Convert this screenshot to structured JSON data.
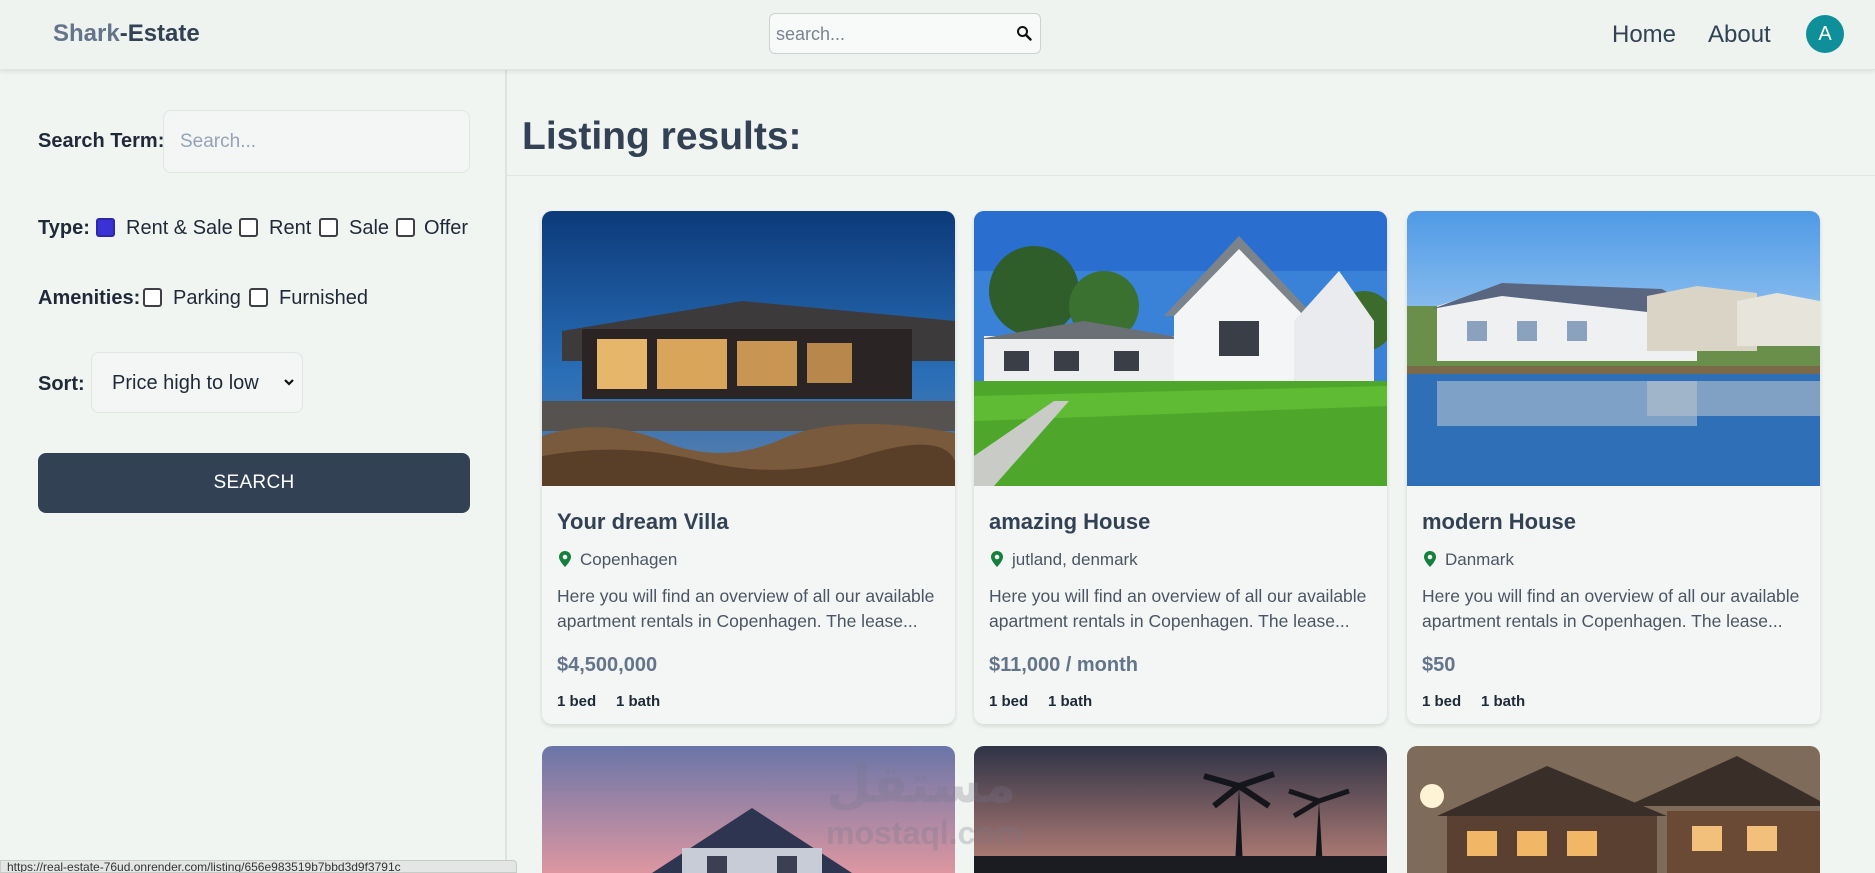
{
  "header": {
    "logo_part1": "Shark",
    "logo_part2": "-Estate",
    "search_placeholder": "search...",
    "nav": {
      "home": "Home",
      "about": "About"
    },
    "avatar_letter": "A"
  },
  "sidebar": {
    "search_term_label": "Search Term:",
    "search_placeholder": "Search...",
    "type_label": "Type:",
    "type_options": [
      {
        "label": "Rent & Sale",
        "checked": true
      },
      {
        "label": "Rent",
        "checked": false
      },
      {
        "label": "Sale",
        "checked": false
      },
      {
        "label": "Offer",
        "checked": false
      }
    ],
    "amenities_label": "Amenities:",
    "amenity_options": [
      {
        "label": "Parking",
        "checked": false
      },
      {
        "label": "Furnished",
        "checked": false
      }
    ],
    "sort_label": "Sort:",
    "sort_value": "Price high to low",
    "search_button": "SEARCH"
  },
  "main": {
    "title": "Listing results:",
    "listings": [
      {
        "title": "Your dream Villa",
        "location": "Copenhagen",
        "description": "Here you will find an overview of all our available apartment rentals in Copenhagen. The lease...",
        "price": "$4,500,000",
        "beds": "1 bed",
        "baths": "1 bath"
      },
      {
        "title": "amazing House",
        "location": "jutland, denmark",
        "description": "Here you will find an overview of all our available apartment rentals in Copenhagen. The lease...",
        "price": "$11,000 / month",
        "beds": "1 bed",
        "baths": "1 bath"
      },
      {
        "title": "modern House",
        "location": "Danmark",
        "description": "Here you will find an overview of all our available apartment rentals in Copenhagen. The lease...",
        "price": "$50",
        "beds": "1 bed",
        "baths": "1 bath"
      }
    ]
  },
  "watermark": {
    "arabic": "مستقل",
    "latin": "mostaql.com"
  },
  "status_url": "https://real-estate-76ud.onrender.com/listing/656e983519b7bbd3d9f3791c"
}
